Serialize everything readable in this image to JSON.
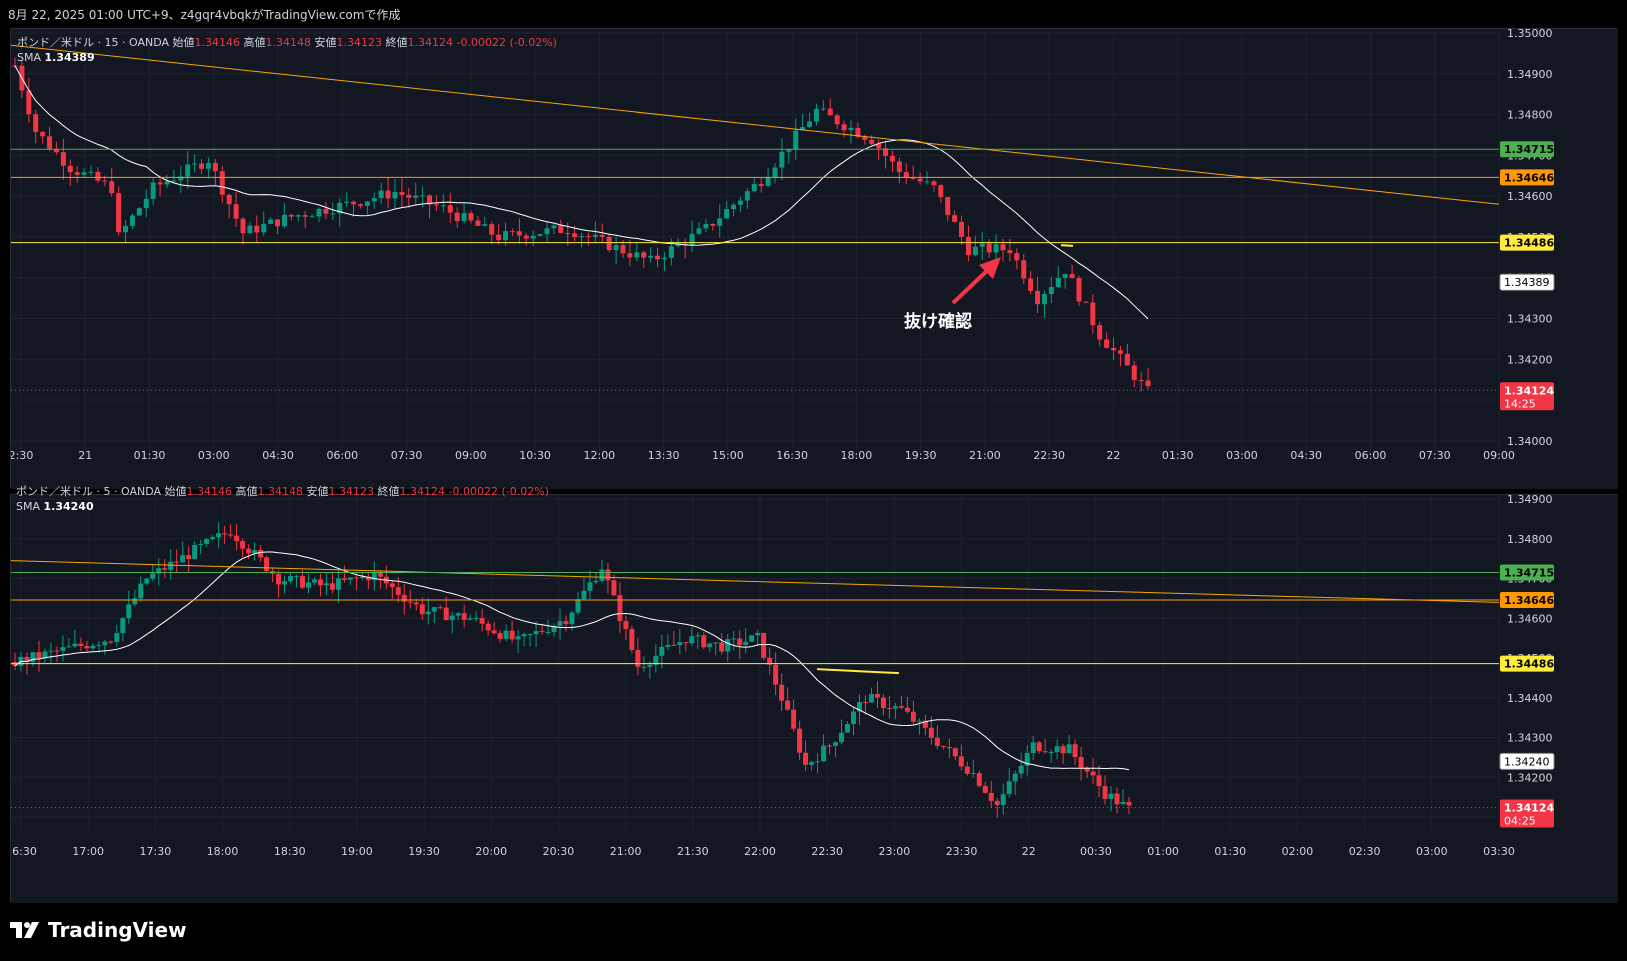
{
  "header": {
    "text": "8月 22, 2025 01:00 UTC+9、z4gqr4vbqkがTradingView.comで作成"
  },
  "brand": {
    "name": "TradingView",
    "icon": "tradingview-logo-icon"
  },
  "colors": {
    "bg": "#131722",
    "up": "#089981",
    "down": "#f23645",
    "grid": "#1e222d",
    "sma": "#ffffff",
    "green": "#4caf50",
    "orange": "#ff9800",
    "yellow": "#ffeb3b",
    "trend": "#f7a600",
    "text": "#d1d4dc"
  },
  "chart_data": [
    {
      "type": "candlestick",
      "symbol": "ポンド／米ドル · 15 · OANDA",
      "ohlc": {
        "open_label": "始値",
        "open": "1.34146",
        "high_label": "高値",
        "high": "1.34148",
        "low_label": "安値",
        "low": "1.34123",
        "close_label": "終値",
        "close": "1.34124",
        "change": "-0.00022 (-0.02%)"
      },
      "sma_label": "SMA",
      "sma_value": "1.34389",
      "ylim": [
        1.3398,
        1.35
      ],
      "y_ticks": [
        "1.35000",
        "1.34900",
        "1.34800",
        "1.34700",
        "1.34600",
        "1.34500",
        "1.34400",
        "1.34300",
        "1.34200",
        "1.34100",
        "1.34000"
      ],
      "x_ticks": [
        "2:30",
        "21",
        "01:30",
        "03:00",
        "04:30",
        "06:00",
        "07:30",
        "09:00",
        "10:30",
        "12:00",
        "13:30",
        "15:00",
        "16:30",
        "18:00",
        "19:30",
        "21:00",
        "22:30",
        "22",
        "01:30",
        "03:00",
        "04:30",
        "06:00",
        "07:30",
        "09:00"
      ],
      "levels": [
        {
          "price": 1.34715,
          "label": "1.34715",
          "color": "#4caf50"
        },
        {
          "price": 1.34646,
          "label": "1.34646",
          "color": "#ff9800"
        },
        {
          "price": 1.34486,
          "label": "1.34486",
          "color": "#ffeb3b"
        }
      ],
      "sma_tag": "1.34389",
      "last_price": {
        "price": 1.34124,
        "label": "1.34124",
        "countdown": "14:25"
      },
      "annotation": "抜け確認"
    },
    {
      "type": "candlestick",
      "symbol": "ポンド／米ドル · 5 · OANDA",
      "ohlc": {
        "open_label": "始値",
        "open": "1.34146",
        "high_label": "高値",
        "high": "1.34148",
        "low_label": "安値",
        "low": "1.34123",
        "close_label": "終値",
        "close": "1.34124",
        "change": "-0.00022 (-0.02%)"
      },
      "sma_label": "SMA",
      "sma_value": "1.34240",
      "ylim": [
        1.3408,
        1.349
      ],
      "y_ticks": [
        "1.34900",
        "1.34800",
        "1.34700",
        "1.34600",
        "1.34500",
        "1.34400",
        "1.34300",
        "1.34200",
        "1.34100"
      ],
      "x_ticks": [
        "16:30",
        "17:00",
        "17:30",
        "18:00",
        "18:30",
        "19:00",
        "19:30",
        "20:00",
        "20:30",
        "21:00",
        "21:30",
        "22:00",
        "22:30",
        "23:00",
        "23:30",
        "22",
        "00:30",
        "01:00",
        "01:30",
        "02:00",
        "02:30",
        "03:00",
        "03:30"
      ],
      "levels": [
        {
          "price": 1.34715,
          "label": "1.34715",
          "color": "#4caf50"
        },
        {
          "price": 1.34646,
          "label": "1.34646",
          "color": "#ff9800"
        },
        {
          "price": 1.34486,
          "label": "1.34486",
          "color": "#ffeb3b"
        }
      ],
      "sma_tag": "1.34240",
      "last_price": {
        "price": 1.34124,
        "label": "1.34124",
        "countdown": "04:25"
      }
    }
  ]
}
